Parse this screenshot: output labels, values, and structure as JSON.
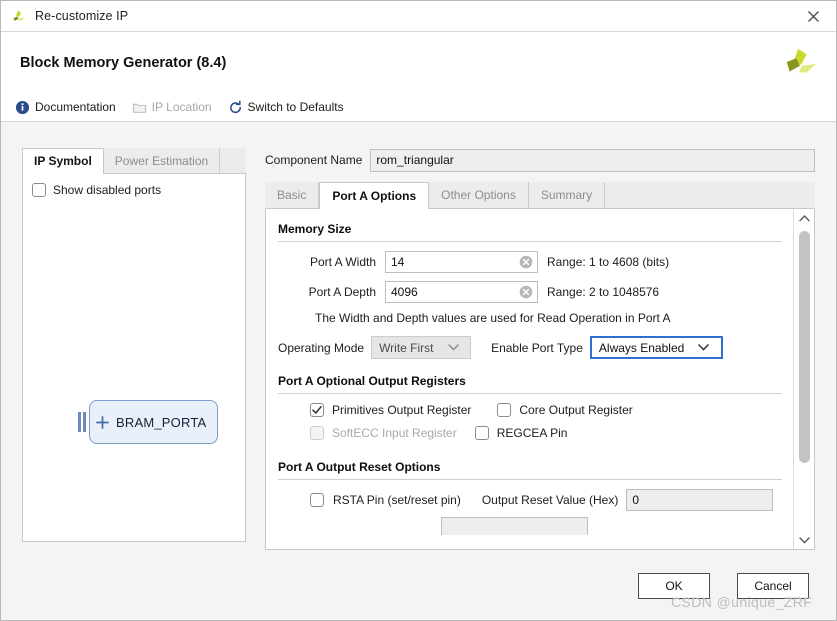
{
  "window": {
    "title": "Re-customize IP",
    "title_icon": "xilinx-logo-icon",
    "close_icon": "close-icon"
  },
  "header": {
    "title": "Block Memory Generator (8.4)",
    "vendor_logo": "xilinx-logo-icon"
  },
  "toolbar": {
    "items": [
      {
        "label": "Documentation",
        "icon": "info-icon",
        "disabled": false
      },
      {
        "label": "IP Location",
        "icon": "folder-icon",
        "disabled": true
      },
      {
        "label": "Switch to Defaults",
        "icon": "refresh-icon",
        "disabled": false
      }
    ]
  },
  "left_panel": {
    "tabs": [
      {
        "label": "IP Symbol",
        "active": true
      },
      {
        "label": "Power Estimation",
        "active": false
      }
    ],
    "show_disabled_ports": {
      "label": "Show disabled ports",
      "checked": false
    },
    "symbol": {
      "block_label": "BRAM_PORTA",
      "expander_icon": "plus-icon",
      "port_icon": "port-bus-icon"
    }
  },
  "right_panel": {
    "component_name": {
      "label": "Component Name",
      "value": "rom_triangular"
    },
    "tabs": [
      {
        "label": "Basic",
        "active": false
      },
      {
        "label": "Port A Options",
        "active": true
      },
      {
        "label": "Other Options",
        "active": false
      },
      {
        "label": "Summary",
        "active": false
      }
    ],
    "memory_size": {
      "title": "Memory Size",
      "port_a_width": {
        "label": "Port A Width",
        "value": "14",
        "range": "Range: 1 to 4608 (bits)",
        "clear_icon": "clear-circle-icon"
      },
      "port_a_depth": {
        "label": "Port A Depth",
        "value": "4096",
        "range": "Range: 2 to 1048576",
        "clear_icon": "clear-circle-icon"
      },
      "note": "The Width and Depth values are used for Read Operation in Port A",
      "operating_mode": {
        "label": "Operating Mode",
        "value": "Write First",
        "disabled": true,
        "arrow_icon": "chevron-down-icon"
      },
      "enable_port_type": {
        "label": "Enable Port Type",
        "value": "Always Enabled",
        "focused": true,
        "arrow_icon": "chevron-down-icon"
      }
    },
    "output_registers": {
      "title": "Port A Optional Output Registers",
      "primitives_output_register": {
        "label": "Primitives Output Register",
        "checked": true,
        "disabled": false
      },
      "core_output_register": {
        "label": "Core Output Register",
        "checked": false,
        "disabled": false
      },
      "softecc_input_register": {
        "label": "SoftECC Input Register",
        "checked": false,
        "disabled": true
      },
      "regcea_pin": {
        "label": "REGCEA Pin",
        "checked": false,
        "disabled": false
      }
    },
    "output_reset": {
      "title": "Port A Output Reset Options",
      "rsta_pin": {
        "label": "RSTA Pin (set/reset pin)",
        "checked": false
      },
      "output_reset_value": {
        "label": "Output Reset Value (Hex)",
        "value": "0"
      }
    },
    "scrollbar": {
      "up_icon": "chevron-up-icon",
      "down_icon": "chevron-down-icon",
      "thumb_icon": "scroll-thumb"
    }
  },
  "footer": {
    "ok_label": "OK",
    "cancel_label": "Cancel",
    "watermark": "CSDN @unique_ZRF"
  },
  "colors": {
    "accent_blue": "#2f6fd0",
    "symbol_fill": "#e9f0fa",
    "symbol_border": "#7b9bc9",
    "logo_green": "#c8d92b",
    "logo_olive": "#7d8a1c"
  }
}
